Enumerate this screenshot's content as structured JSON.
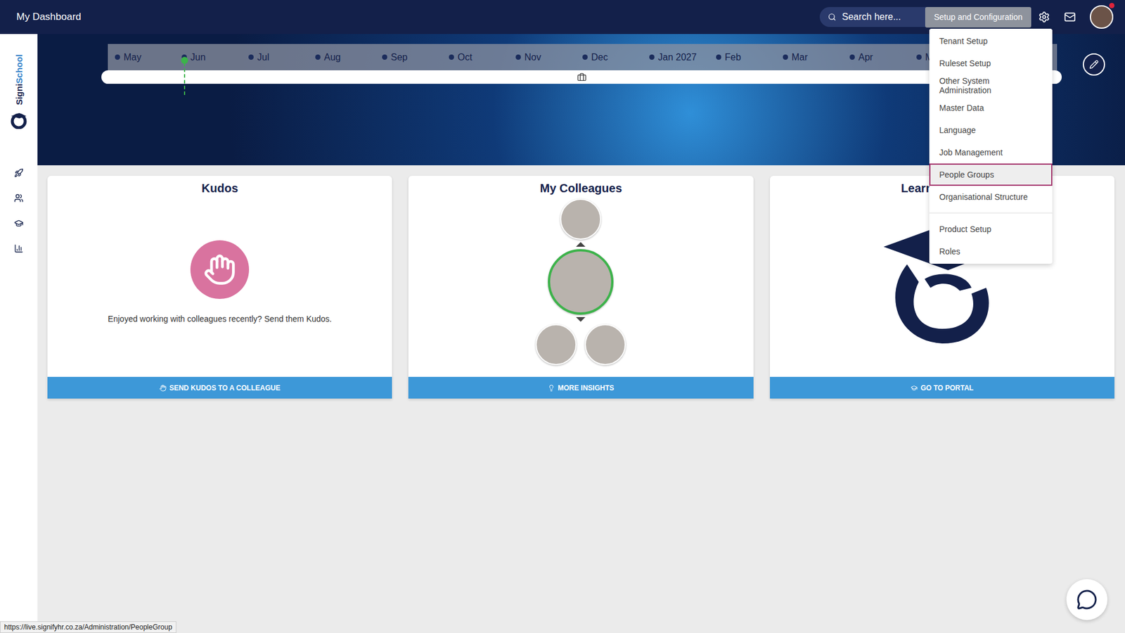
{
  "topbar": {
    "title": "My Dashboard",
    "search_placeholder": "Search here...",
    "setup_button": "Setup and Configuration",
    "notification": true
  },
  "sidebar": {
    "logo": [
      "Signi",
      "School"
    ]
  },
  "timeline": {
    "months": [
      {
        "label": "May",
        "selected": false
      },
      {
        "label": "Jun",
        "selected": true
      },
      {
        "label": "Jul",
        "selected": false
      },
      {
        "label": "Aug",
        "selected": false
      },
      {
        "label": "Sep",
        "selected": false
      },
      {
        "label": "Oct",
        "selected": false
      },
      {
        "label": "Nov",
        "selected": false
      },
      {
        "label": "Dec",
        "selected": false
      },
      {
        "label": "Jan 2027",
        "selected": false
      },
      {
        "label": "Feb",
        "selected": false
      },
      {
        "label": "Mar",
        "selected": false
      },
      {
        "label": "Apr",
        "selected": false
      },
      {
        "label": "M",
        "selected": false
      }
    ]
  },
  "cards": [
    {
      "title": "Kudos",
      "kind": "kudos",
      "text": "Enjoyed working with colleagues recently? Send them Kudos.",
      "button": "SEND KUDOS TO A COLLEAGUE"
    },
    {
      "title": "My Colleagues",
      "kind": "colleagues",
      "text": "",
      "button": "MORE INSIGHTS"
    },
    {
      "title": "Learn",
      "kind": "learning",
      "text": "",
      "button": "GO TO PORTAL"
    }
  ],
  "menu": {
    "items": [
      {
        "label": "Tenant Setup",
        "selected": false,
        "divider_before": false
      },
      {
        "label": "Ruleset Setup",
        "selected": false,
        "divider_before": false
      },
      {
        "label": "Other System Administration",
        "selected": false,
        "divider_before": false
      },
      {
        "label": "Master Data",
        "selected": false,
        "divider_before": false
      },
      {
        "label": "Language",
        "selected": false,
        "divider_before": false
      },
      {
        "label": "Job Management",
        "selected": false,
        "divider_before": false
      },
      {
        "label": "People Groups",
        "selected": true,
        "divider_before": false
      },
      {
        "label": "Organisational Structure",
        "selected": false,
        "divider_before": false
      },
      {
        "label": "Product Setup",
        "selected": false,
        "divider_before": true
      },
      {
        "label": "Roles",
        "selected": false,
        "divider_before": false
      }
    ]
  },
  "status_bar": "https://live.signifyhr.co.za/Administration/PeopleGroup"
}
